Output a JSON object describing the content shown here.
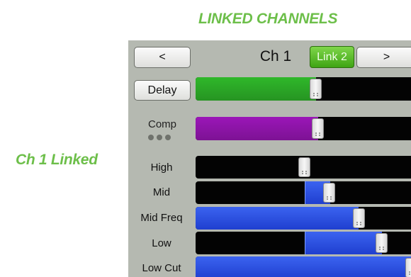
{
  "heading": "LINKED CHANNELS",
  "side_label": "Ch 1 Linked",
  "header": {
    "prev_label": "<",
    "channel_title": "Ch 1",
    "link_label": "Link 2",
    "next_label": ">"
  },
  "rows": {
    "delay": {
      "label": "Delay",
      "value": 0.53,
      "color": "#2fb82a"
    },
    "comp": {
      "label": "Comp",
      "value": 0.54,
      "color": "#9b16b8"
    },
    "high": {
      "label": "High",
      "value": 0.48,
      "center": 0.48
    },
    "mid": {
      "label": "Mid",
      "value": 0.59,
      "center": 0.48
    },
    "mid_freq": {
      "label": "Mid Freq",
      "value": 0.72
    },
    "low": {
      "label": "Low",
      "value": 0.82,
      "center": 0.48
    },
    "low_cut": {
      "label": "Low Cut",
      "value": 0.95
    }
  },
  "colors": {
    "heading": "#6dbf4a",
    "panel_bg": "#b5b9b1",
    "link_active": "#5ac12a",
    "eq_fill": "#1f3fd0"
  }
}
